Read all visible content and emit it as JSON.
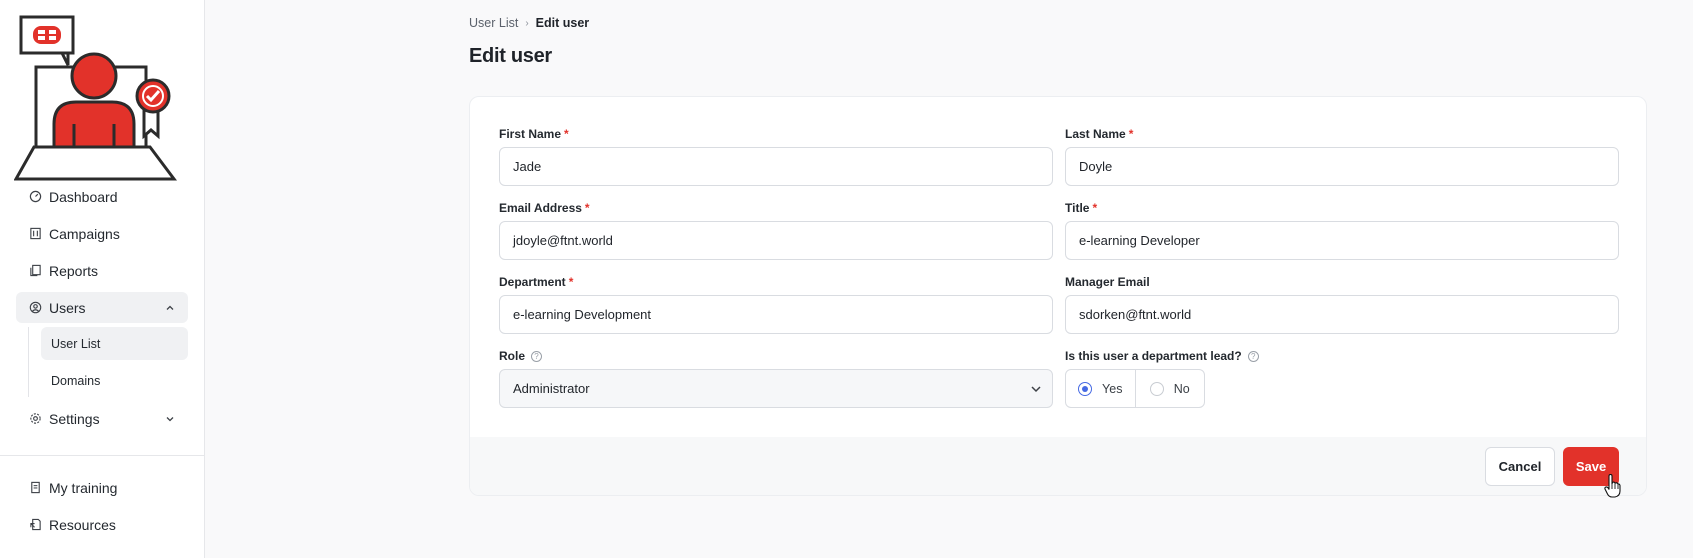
{
  "sidebar": {
    "items": [
      {
        "label": "Dashboard",
        "icon": "dashboard-gauge-icon"
      },
      {
        "label": "Campaigns",
        "icon": "campaigns-icon"
      },
      {
        "label": "Reports",
        "icon": "reports-icon"
      },
      {
        "label": "Users",
        "icon": "user-circle-icon",
        "expanded": true,
        "children": [
          {
            "label": "User List",
            "active": true
          },
          {
            "label": "Domains"
          }
        ]
      },
      {
        "label": "Settings",
        "icon": "gear-icon",
        "expanded": false
      }
    ],
    "bottom_items": [
      {
        "label": "My training",
        "icon": "training-icon"
      },
      {
        "label": "Resources",
        "icon": "resources-icon"
      }
    ]
  },
  "breadcrumb": {
    "parent": "User List",
    "current": "Edit user"
  },
  "page": {
    "title": "Edit user"
  },
  "form": {
    "first_name": {
      "label": "First Name",
      "required": "*",
      "value": "Jade"
    },
    "last_name": {
      "label": "Last Name",
      "required": "*",
      "value": "Doyle"
    },
    "email": {
      "label": "Email Address",
      "required": "*",
      "value": "jdoyle@ftnt.world"
    },
    "title": {
      "label": "Title",
      "required": "*",
      "value": "e-learning Developer"
    },
    "department": {
      "label": "Department",
      "required": "*",
      "value": "e-learning Development"
    },
    "manager_email": {
      "label": "Manager Email",
      "value": "sdorken@ftnt.world"
    },
    "role": {
      "label": "Role",
      "help": "?",
      "value": "Administrator"
    },
    "department_lead": {
      "label": "Is this user a department lead?",
      "help": "?",
      "options": [
        "Yes",
        "No"
      ],
      "selected": "Yes"
    }
  },
  "actions": {
    "cancel": "Cancel",
    "save": "Save"
  },
  "colors": {
    "accent_red": "#e2322a",
    "radio_blue": "#4569e3"
  }
}
